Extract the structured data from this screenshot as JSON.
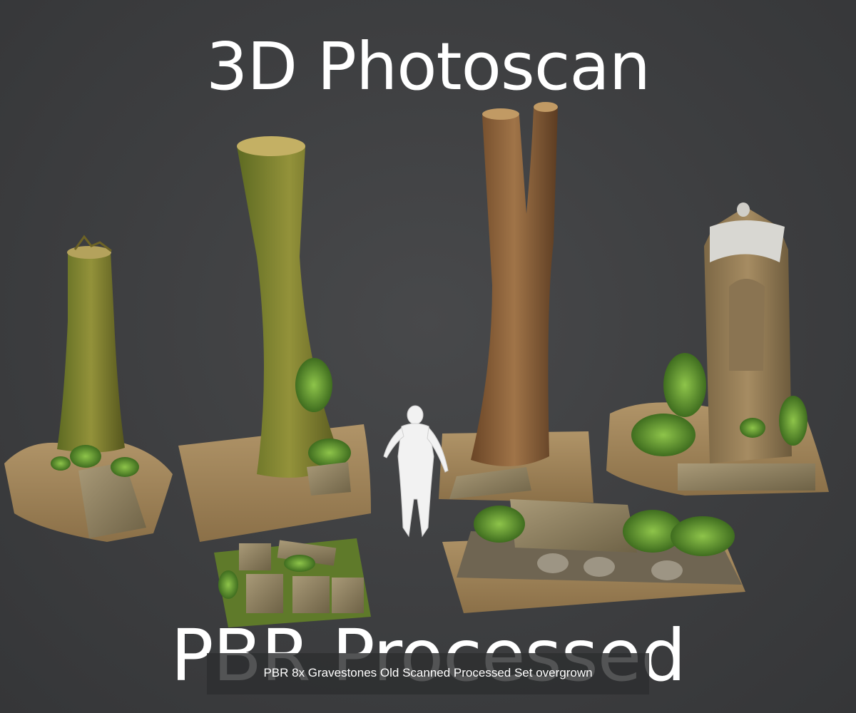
{
  "image": {
    "headline_top": "3D Photoscan",
    "headline_bottom": "PBR Processed",
    "caption": "PBR 8x Gravestones Old Scanned Processed Set overgrown"
  },
  "colors": {
    "background": "#3f4042",
    "text": "#ffffff",
    "moss": "#6b8a2e",
    "bark": "#7a5a34",
    "stone": "#8a7a5a",
    "ground": "#a88a5e",
    "caption_bar": "#2d2e30"
  }
}
